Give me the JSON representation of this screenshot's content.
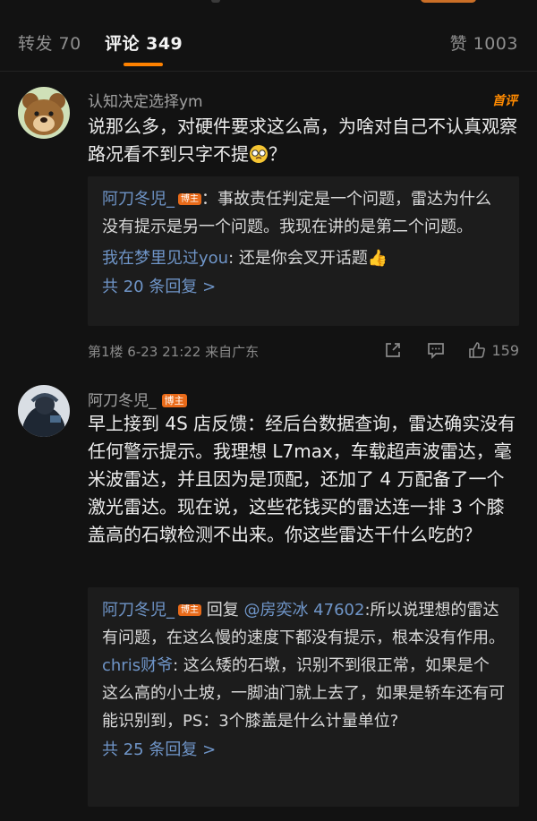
{
  "tabs": {
    "repost": "转发 70",
    "comments": "评论 349",
    "likes": "赞 1003"
  },
  "comment1": {
    "user": "认知决定选择ym",
    "hot_label": "首评",
    "text": "说那么多，对硬件要求这么高，为啥对自己不认真观察路况看不到只字不提",
    "text_end": "？",
    "replies": [
      {
        "name": "阿刀冬児_",
        "badge": "博主",
        "sep": "：",
        "text": "事故责任判定是一个问题，雷达为什么没有提示是另一个问题。我现在讲的是第二个问题。"
      },
      {
        "name": "我在梦里见过you",
        "sep": ": ",
        "text": "还是你会叉开话题👍"
      }
    ],
    "more": "共 20 条回复 >",
    "meta": "第1楼 6-23 21:22 来自广东",
    "likes": "159"
  },
  "comment2": {
    "user": "阿刀冬児_",
    "badge": "博主",
    "text": "早上接到 4S 店反馈：经后台数据查询，雷达确实没有任何警示提示。我理想 L7max，车载超声波雷达，毫米波雷达，并且因为是顶配，还加了 4 万配备了一个激光雷达。现在说，这些花钱买的雷达连一排 3 个膝盖高的石墩检测不出来。你这些雷达干什么吃的？",
    "replies": [
      {
        "name": "阿刀冬児_",
        "badge": "博主",
        "reply_word": " 回复 ",
        "mention": "@房奕冰 47602",
        "sep": ":",
        "text": "所以说理想的雷达有问题，在这么慢的速度下都没有提示，根本没有作用。"
      },
      {
        "name": "chris财爷",
        "sep": ": ",
        "text": "这么矮的石墩，识别不到很正常，如果是个这么高的小土坡，一脚油门就上去了，如果是轿车还有可能识别到，PS：3个膝盖是什么计量单位?"
      }
    ],
    "more": "共 25 条回复 >"
  },
  "icons": {
    "share": "share-icon",
    "comment": "comment-icon",
    "like": "thumbs-up-icon",
    "emoji": "emoji-icon"
  },
  "colors": {
    "accent": "#ff8200",
    "link": "#6f95c8",
    "badge": "#e86a19",
    "background": "#121212"
  }
}
